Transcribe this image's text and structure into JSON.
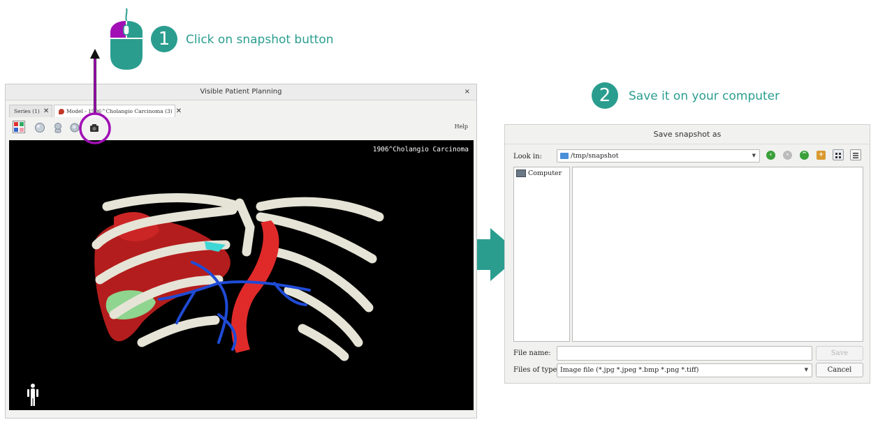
{
  "steps": [
    {
      "number": "1",
      "text": "Click on snapshot button"
    },
    {
      "number": "2",
      "text": "Save it on your computer"
    }
  ],
  "colors": {
    "accent": "#2a9d8f",
    "highlight": "#a10fb5"
  },
  "app": {
    "title": "Visible Patient Planning",
    "close": "×",
    "tabs": [
      {
        "label": "Series (1)",
        "close": "✕"
      },
      {
        "label": "Model - 1906^Cholangio Carcinoma (3)",
        "close": "✕"
      }
    ],
    "toolbar": {
      "help": "Help"
    },
    "viewer": {
      "patient_label": "1906^Cholangio Carcinoma"
    }
  },
  "dialog": {
    "title": "Save snapshot as",
    "look_in_label": "Look in:",
    "look_in_value": "/tmp/snapshot",
    "sidebar_items": [
      "Computer"
    ],
    "file_name_label": "File name:",
    "file_name_value": "",
    "files_of_type_label": "Files of type:",
    "files_of_type_value": "Image file (*.jpg *.jpeg *.bmp *.png *.tiff)",
    "save_button": "Save",
    "cancel_button": "Cancel"
  }
}
